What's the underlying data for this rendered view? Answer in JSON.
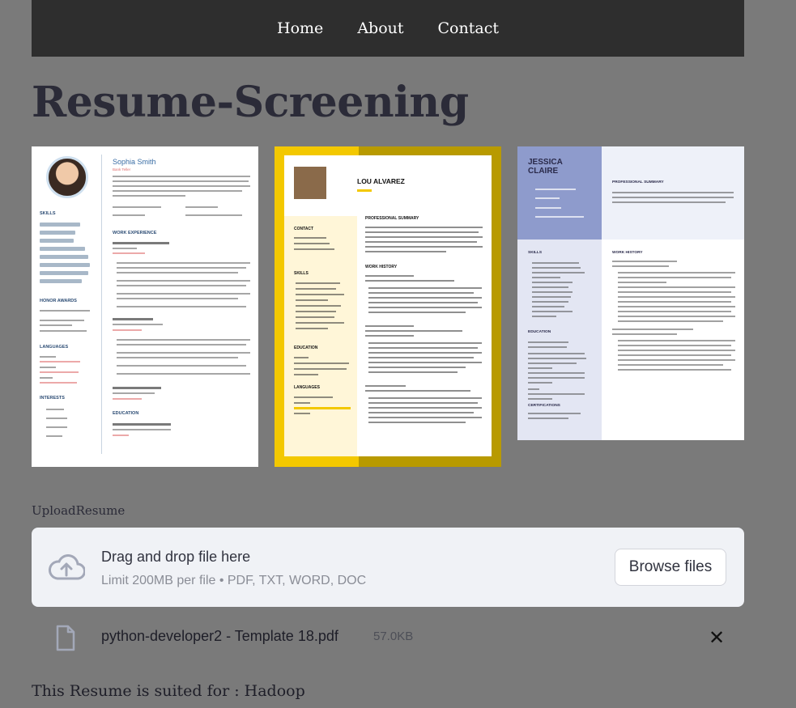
{
  "nav": {
    "items": [
      {
        "label": "Home"
      },
      {
        "label": "About"
      },
      {
        "label": "Contact"
      }
    ]
  },
  "page": {
    "title": "Resume-Screening"
  },
  "templates": {
    "t1": {
      "name": "Sophia Smith",
      "role": "Bank Teller",
      "sections": [
        "SKILLS",
        "HONOR AWARDS",
        "LANGUAGES",
        "INTERESTS",
        "WORK EXPERIENCE",
        "EDUCATION"
      ]
    },
    "t2": {
      "name": "LOU  ALVAREZ",
      "sections": [
        "CONTACT",
        "PROFESSIONAL SUMMARY",
        "SKILLS",
        "WORK HISTORY",
        "EDUCATION",
        "LANGUAGES"
      ]
    },
    "t3": {
      "name_line1": "JESSICA",
      "name_line2": "CLAIRE",
      "sections": [
        "PROFESSIONAL SUMMARY",
        "SKILLS",
        "WORK HISTORY",
        "EDUCATION",
        "CERTIFICATIONS"
      ]
    }
  },
  "upload": {
    "label": "UploadResume",
    "drop_title": "Drag and drop file here",
    "drop_subtitle": "Limit 200MB per file • PDF, TXT, WORD, DOC",
    "browse_label": "Browse files",
    "file": {
      "name": "python-developer2 - Template 18.pdf",
      "size": "57.0KB"
    },
    "icons": {
      "upload": "cloud-upload-icon",
      "file": "file-icon",
      "remove": "close-icon"
    }
  },
  "result": {
    "text": "This Resume is suited for : Hadoop"
  }
}
